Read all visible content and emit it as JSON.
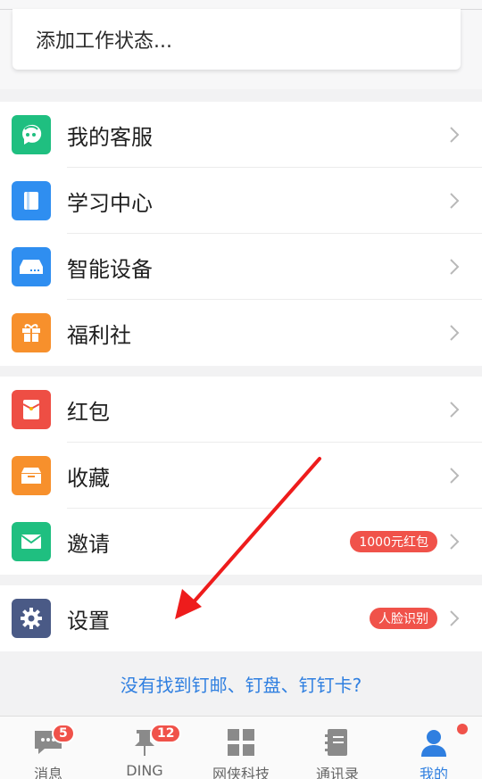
{
  "status_card": {
    "placeholder": "添加工作状态..."
  },
  "menu_groups": [
    {
      "items": [
        {
          "label": "我的客服",
          "icon": "customer-service-icon",
          "color": "#1fbf80"
        },
        {
          "label": "学习中心",
          "icon": "book-icon",
          "color": "#2f8ef0"
        },
        {
          "label": "智能设备",
          "icon": "device-icon",
          "color": "#2f8ef0"
        },
        {
          "label": "福利社",
          "icon": "gift-icon",
          "color": "#f7902c"
        }
      ]
    },
    {
      "items": [
        {
          "label": "红包",
          "icon": "red-envelope-icon",
          "color": "#ee4e44"
        },
        {
          "label": "收藏",
          "icon": "favorites-box-icon",
          "color": "#f7902c"
        },
        {
          "label": "邀请",
          "icon": "mail-icon",
          "color": "#1fbf80",
          "badge": "1000元红包"
        }
      ]
    },
    {
      "items": [
        {
          "label": "设置",
          "icon": "gear-icon",
          "color": "#4a5a86",
          "badge": "人脸识别"
        }
      ]
    }
  ],
  "bottom_link": "没有找到钉邮、钉盘、钉钉卡?",
  "tabs": [
    {
      "label": "消息",
      "icon": "chat-icon",
      "badge": "5"
    },
    {
      "label": "DING",
      "icon": "pin-icon",
      "badge": "12"
    },
    {
      "label": "网侠科技",
      "icon": "grid-icon"
    },
    {
      "label": "通讯录",
      "icon": "contacts-book-icon"
    },
    {
      "label": "我的",
      "icon": "person-icon",
      "active": true,
      "dot": true
    }
  ],
  "colors": {
    "accent": "#2f7fe0",
    "badge": "#f0524a",
    "annotation_arrow": "#ee1c1c"
  }
}
